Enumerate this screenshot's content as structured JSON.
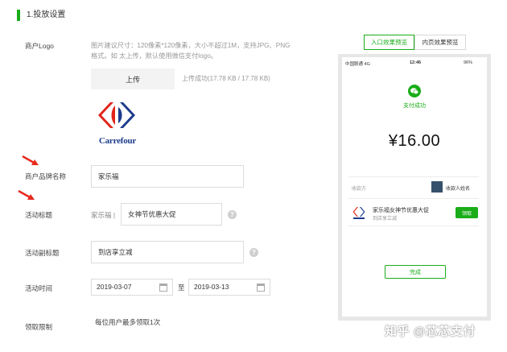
{
  "section": {
    "title": "1.投放设置"
  },
  "form": {
    "logo_label": "商户Logo",
    "logo_hint": "图片建议尺寸：120像素*120像素，大小不超过1M，支持JPG、PNG格式。如 太上传，默认使用微信支付logo。",
    "upload_label": "上传",
    "upload_status": "上传成功(17.78 KB / 17.78 KB)",
    "logo_image_text": "Carrefour",
    "brand_label": "商户品牌名称",
    "brand_value": "家乐福",
    "title_label": "活动标题",
    "title_prefix": "家乐福 |",
    "title_value": "女神节优惠大促",
    "subtitle_label": "活动副标题",
    "subtitle_value": "到店享立减",
    "time_label": "活动时间",
    "start_date": "2019-03-07",
    "to_text": "至",
    "end_date": "2019-03-13",
    "limit_label": "领取限制",
    "limit_value": "每位用户最多领取1次"
  },
  "preview": {
    "tab_active": "入口效果预览",
    "tab_inactive": "内页效果预览",
    "carrier": "中国联通",
    "network": "4G",
    "time": "12:46",
    "battery": "96%",
    "success_text": "支付成功",
    "amount": "¥16.00",
    "payee_label": "收款方",
    "payee_name": "收款人姓名",
    "coupon_title": "家乐福女神节优惠大促",
    "coupon_sub": "到店享立减",
    "claim_label": "领取",
    "done_label": "完成"
  },
  "watermark": "知乎 @芯芯支付",
  "colors": {
    "accent": "#1aad19",
    "arrow": "#e8281c",
    "carrefour_red": "#e2231a",
    "carrefour_blue": "#1d3b8c"
  }
}
